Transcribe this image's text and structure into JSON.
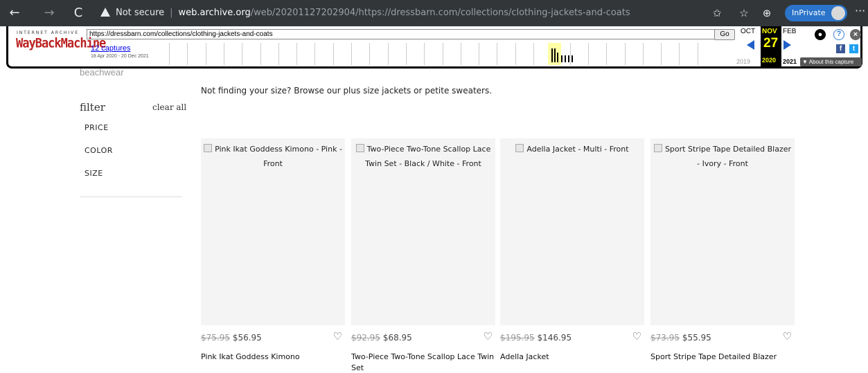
{
  "browser": {
    "back": "←",
    "forward": "→",
    "reload": "C",
    "security": "Not secure",
    "url_host": "web.archive.org",
    "url_path": "/web/20201127202904/https://dressbarn.com/collections/clothing-jackets-and-coats",
    "inprivate": "InPrivate",
    "more": "···"
  },
  "wayback": {
    "ia_label": "INTERNET ARCHIVE",
    "logo": "WayBackMachine",
    "url": "https://dressbarn.com/collections/clothing-jackets-and-coats",
    "go": "Go",
    "captures": "12 captures",
    "range": "18 Apr 2020 - 20 Dec 2021",
    "prev_month": "OCT",
    "cur_month": "NOV",
    "cur_day": "27",
    "next_month": "FEB",
    "prev_year": "2019",
    "cur_year": "2020",
    "next_year": "2021",
    "about": "▼ About this capture"
  },
  "page": {
    "cut_text": "beachwear",
    "notice": "Not finding your size? Browse our plus size jackets or petite sweaters."
  },
  "filter": {
    "title": "filter",
    "clear": "clear all",
    "items": [
      "PRICE",
      "COLOR",
      "SIZE"
    ]
  },
  "products": [
    {
      "alt": "Pink Ikat Goddess Kimono - Pink - Front",
      "old_price": "$75.95",
      "price": "$56.95",
      "name": "Pink Ikat Goddess Kimono"
    },
    {
      "alt": "Two-Piece Two-Tone Scallop Lace Twin Set - Black / White - Front",
      "old_price": "$92.95",
      "price": "$68.95",
      "name": "Two-Piece Two-Tone Scallop Lace Twin Set"
    },
    {
      "alt": "Adella Jacket - Multi - Front",
      "old_price": "$195.95",
      "price": "$146.95",
      "name": "Adella Jacket"
    },
    {
      "alt": "Sport Stripe Tape Detailed Blazer - Ivory - Front",
      "old_price": "$73.95",
      "price": "$55.95",
      "name": "Sport Stripe Tape Detailed Blazer"
    }
  ],
  "icons": {
    "heart": "heart-icon",
    "broken_image": "broken-image-icon"
  }
}
